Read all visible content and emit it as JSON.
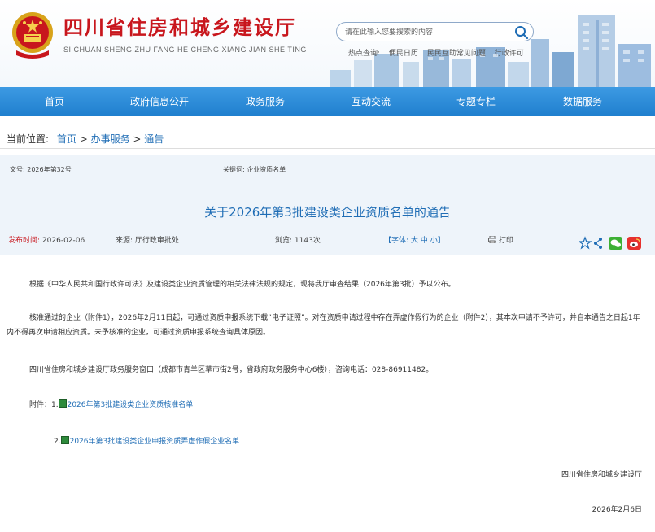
{
  "header": {
    "title": "四川省住房和城乡建设厅",
    "subtitle": "SI CHUAN SHENG ZHU FANG HE CHENG XIANG JIAN SHE TING",
    "search_placeholder": "请在此输入您要搜索的内容",
    "hot_label": "热点查询:",
    "hot_links": [
      "便民日历",
      "民民互助常见问题",
      "行政许可"
    ]
  },
  "nav": {
    "items": [
      "首页",
      "政府信息公开",
      "政务服务",
      "互动交流",
      "专题专栏",
      "数据服务"
    ]
  },
  "breadcrumb": {
    "label": "当前位置:",
    "home": "首页",
    "sep1": " > ",
    "section": "办事服务",
    "sep2": " > ",
    "current": "通告"
  },
  "meta": {
    "doc_no": "文号: 2026年第32号",
    "keywords": "关键词: 企业资质名单"
  },
  "article": {
    "title": "关于2026年第3批建设类企业资质名单的通告",
    "publish_label": "发布时间:",
    "publish_date": "2026-02-06",
    "source_label": "来源:",
    "source": "厅行政审批处",
    "views_label": "浏览:",
    "views": "1143次",
    "font_label": "【字体:",
    "font_large": "大",
    "font_medium": "中",
    "font_small": "小",
    "font_end": "】",
    "print": "打印",
    "para1": "根据《中华人民共和国行政许可法》及建设类企业资质管理的相关法律法规的规定，现将我厅审查结果（2026年第3批）予以公布。",
    "para2": "核准通过的企业（附件1），2026年2月11日起，可通过资质申报系统下载“电子证照”。对在资质申请过程中存在弄虚作假行为的企业（附件2），其本次申请不予许可，并自本通告之日起1年内不得再次申请相应资质。未予核准的企业，可通过资质申报系统查询具体原因。",
    "para3": "四川省住房和城乡建设厅政务服务窗口（成都市青羊区草市街2号，省政府政务服务中心6楼），咨询电话：028-86911482。",
    "attach_label": "附件：1.",
    "attach1": "2026年第3批建设类企业资质核准名单",
    "attach2_num": "2.",
    "attach2": "2026年第3批建设类企业申报资质弄虚作假企业名单",
    "signature": "四川省住房和城乡建设厅",
    "date": "2026年2月6日"
  }
}
